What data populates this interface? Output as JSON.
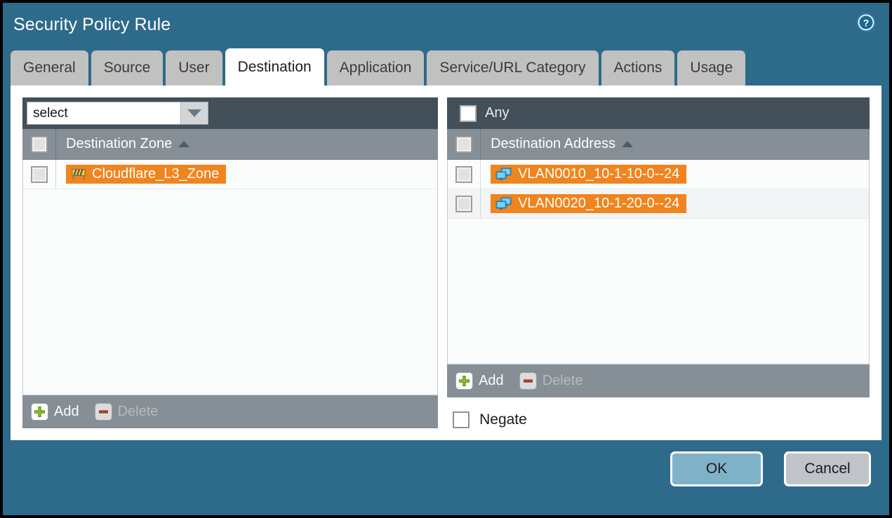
{
  "dialog": {
    "title": "Security Policy Rule",
    "help_icon": "help-circle-icon",
    "accent_teal": "#2e6a8a",
    "accent_orange": "#f0841e",
    "panel_dark": "#434f59",
    "panel_grey": "#868e96"
  },
  "tabs": [
    {
      "label": "General",
      "active": false
    },
    {
      "label": "Source",
      "active": false
    },
    {
      "label": "User",
      "active": false
    },
    {
      "label": "Destination",
      "active": true
    },
    {
      "label": "Application",
      "active": false
    },
    {
      "label": "Service/URL Category",
      "active": false
    },
    {
      "label": "Actions",
      "active": false
    },
    {
      "label": "Usage",
      "active": false
    }
  ],
  "left_panel": {
    "select": {
      "value": "select",
      "placeholder": "select",
      "arrow_icon": "chevron-down-icon"
    },
    "column_header": "Destination Zone",
    "sort_icon": "sort-ascending-icon",
    "rows": [
      {
        "label": "Cloudflare_L3_Zone",
        "icon": "zone-barrier-icon",
        "checked": false
      }
    ],
    "toolbar": {
      "add_label": "Add",
      "add_icon": "plus-icon",
      "delete_label": "Delete",
      "delete_icon": "minus-icon",
      "delete_disabled": true
    }
  },
  "right_panel": {
    "any": {
      "label": "Any",
      "checked": false
    },
    "column_header": "Destination Address",
    "sort_icon": "sort-ascending-icon",
    "rows": [
      {
        "label": "VLAN0010_10-1-10-0--24",
        "icon": "address-object-icon",
        "checked": false
      },
      {
        "label": "VLAN0020_10-1-20-0--24",
        "icon": "address-object-icon",
        "checked": false
      }
    ],
    "toolbar": {
      "add_label": "Add",
      "add_icon": "plus-icon",
      "delete_label": "Delete",
      "delete_icon": "minus-icon",
      "delete_disabled": true
    },
    "negate": {
      "label": "Negate",
      "checked": false
    }
  },
  "footer": {
    "ok_label": "OK",
    "cancel_label": "Cancel"
  }
}
